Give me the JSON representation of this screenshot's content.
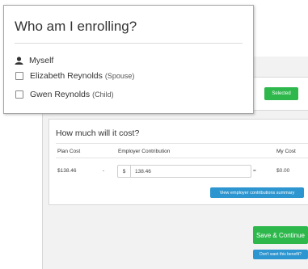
{
  "benefit_card": {
    "selected_label": "Selected"
  },
  "cost": {
    "title": "How much will it cost?",
    "headers": {
      "plan_cost": "Plan Cost",
      "employer_contribution": "Employer Contribution",
      "my_cost": "My Cost"
    },
    "row": {
      "plan_cost": "$138.46",
      "minus": "-",
      "currency": "$",
      "contribution_value": "138.46",
      "equals": "=",
      "my_cost": "$0.00"
    },
    "summary_button": "View employer contributions summary"
  },
  "actions": {
    "save_continue": "Save & Continue",
    "dont_want": "Don't want this benefit?"
  },
  "enrolling": {
    "title": "Who am I enrolling?",
    "myself": "Myself",
    "dependents": [
      {
        "name": "Elizabeth Reynolds",
        "relation": "(Spouse)"
      },
      {
        "name": "Gwen Reynolds",
        "relation": "(Child)"
      }
    ]
  },
  "colors": {
    "green": "#2eb84c",
    "blue": "#2d95cf"
  }
}
